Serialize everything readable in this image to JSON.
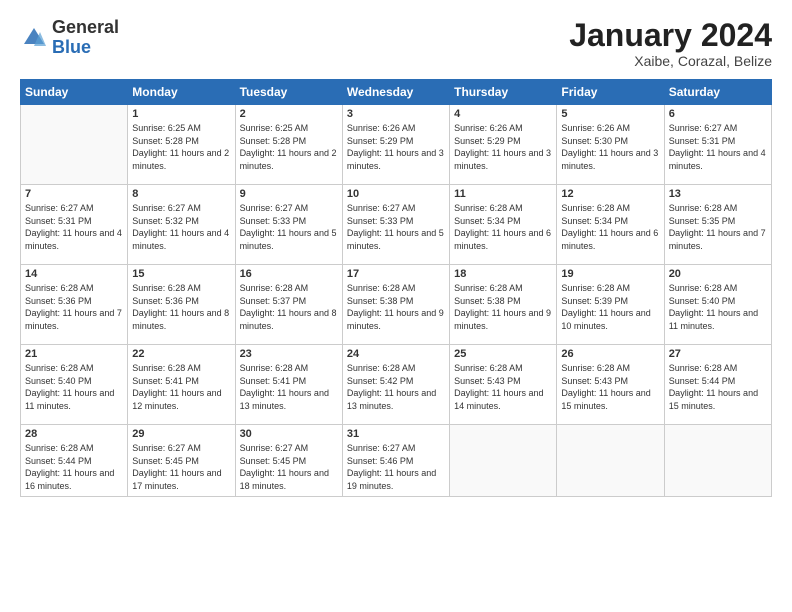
{
  "logo": {
    "general": "General",
    "blue": "Blue"
  },
  "title": "January 2024",
  "location": "Xaibe, Corazal, Belize",
  "weekdays": [
    "Sunday",
    "Monday",
    "Tuesday",
    "Wednesday",
    "Thursday",
    "Friday",
    "Saturday"
  ],
  "weeks": [
    [
      {
        "day": "",
        "sunrise": "",
        "sunset": "",
        "daylight": ""
      },
      {
        "day": "1",
        "sunrise": "Sunrise: 6:25 AM",
        "sunset": "Sunset: 5:28 PM",
        "daylight": "Daylight: 11 hours and 2 minutes."
      },
      {
        "day": "2",
        "sunrise": "Sunrise: 6:25 AM",
        "sunset": "Sunset: 5:28 PM",
        "daylight": "Daylight: 11 hours and 2 minutes."
      },
      {
        "day": "3",
        "sunrise": "Sunrise: 6:26 AM",
        "sunset": "Sunset: 5:29 PM",
        "daylight": "Daylight: 11 hours and 3 minutes."
      },
      {
        "day": "4",
        "sunrise": "Sunrise: 6:26 AM",
        "sunset": "Sunset: 5:29 PM",
        "daylight": "Daylight: 11 hours and 3 minutes."
      },
      {
        "day": "5",
        "sunrise": "Sunrise: 6:26 AM",
        "sunset": "Sunset: 5:30 PM",
        "daylight": "Daylight: 11 hours and 3 minutes."
      },
      {
        "day": "6",
        "sunrise": "Sunrise: 6:27 AM",
        "sunset": "Sunset: 5:31 PM",
        "daylight": "Daylight: 11 hours and 4 minutes."
      }
    ],
    [
      {
        "day": "7",
        "sunrise": "Sunrise: 6:27 AM",
        "sunset": "Sunset: 5:31 PM",
        "daylight": "Daylight: 11 hours and 4 minutes."
      },
      {
        "day": "8",
        "sunrise": "Sunrise: 6:27 AM",
        "sunset": "Sunset: 5:32 PM",
        "daylight": "Daylight: 11 hours and 4 minutes."
      },
      {
        "day": "9",
        "sunrise": "Sunrise: 6:27 AM",
        "sunset": "Sunset: 5:33 PM",
        "daylight": "Daylight: 11 hours and 5 minutes."
      },
      {
        "day": "10",
        "sunrise": "Sunrise: 6:27 AM",
        "sunset": "Sunset: 5:33 PM",
        "daylight": "Daylight: 11 hours and 5 minutes."
      },
      {
        "day": "11",
        "sunrise": "Sunrise: 6:28 AM",
        "sunset": "Sunset: 5:34 PM",
        "daylight": "Daylight: 11 hours and 6 minutes."
      },
      {
        "day": "12",
        "sunrise": "Sunrise: 6:28 AM",
        "sunset": "Sunset: 5:34 PM",
        "daylight": "Daylight: 11 hours and 6 minutes."
      },
      {
        "day": "13",
        "sunrise": "Sunrise: 6:28 AM",
        "sunset": "Sunset: 5:35 PM",
        "daylight": "Daylight: 11 hours and 7 minutes."
      }
    ],
    [
      {
        "day": "14",
        "sunrise": "Sunrise: 6:28 AM",
        "sunset": "Sunset: 5:36 PM",
        "daylight": "Daylight: 11 hours and 7 minutes."
      },
      {
        "day": "15",
        "sunrise": "Sunrise: 6:28 AM",
        "sunset": "Sunset: 5:36 PM",
        "daylight": "Daylight: 11 hours and 8 minutes."
      },
      {
        "day": "16",
        "sunrise": "Sunrise: 6:28 AM",
        "sunset": "Sunset: 5:37 PM",
        "daylight": "Daylight: 11 hours and 8 minutes."
      },
      {
        "day": "17",
        "sunrise": "Sunrise: 6:28 AM",
        "sunset": "Sunset: 5:38 PM",
        "daylight": "Daylight: 11 hours and 9 minutes."
      },
      {
        "day": "18",
        "sunrise": "Sunrise: 6:28 AM",
        "sunset": "Sunset: 5:38 PM",
        "daylight": "Daylight: 11 hours and 9 minutes."
      },
      {
        "day": "19",
        "sunrise": "Sunrise: 6:28 AM",
        "sunset": "Sunset: 5:39 PM",
        "daylight": "Daylight: 11 hours and 10 minutes."
      },
      {
        "day": "20",
        "sunrise": "Sunrise: 6:28 AM",
        "sunset": "Sunset: 5:40 PM",
        "daylight": "Daylight: 11 hours and 11 minutes."
      }
    ],
    [
      {
        "day": "21",
        "sunrise": "Sunrise: 6:28 AM",
        "sunset": "Sunset: 5:40 PM",
        "daylight": "Daylight: 11 hours and 11 minutes."
      },
      {
        "day": "22",
        "sunrise": "Sunrise: 6:28 AM",
        "sunset": "Sunset: 5:41 PM",
        "daylight": "Daylight: 11 hours and 12 minutes."
      },
      {
        "day": "23",
        "sunrise": "Sunrise: 6:28 AM",
        "sunset": "Sunset: 5:41 PM",
        "daylight": "Daylight: 11 hours and 13 minutes."
      },
      {
        "day": "24",
        "sunrise": "Sunrise: 6:28 AM",
        "sunset": "Sunset: 5:42 PM",
        "daylight": "Daylight: 11 hours and 13 minutes."
      },
      {
        "day": "25",
        "sunrise": "Sunrise: 6:28 AM",
        "sunset": "Sunset: 5:43 PM",
        "daylight": "Daylight: 11 hours and 14 minutes."
      },
      {
        "day": "26",
        "sunrise": "Sunrise: 6:28 AM",
        "sunset": "Sunset: 5:43 PM",
        "daylight": "Daylight: 11 hours and 15 minutes."
      },
      {
        "day": "27",
        "sunrise": "Sunrise: 6:28 AM",
        "sunset": "Sunset: 5:44 PM",
        "daylight": "Daylight: 11 hours and 15 minutes."
      }
    ],
    [
      {
        "day": "28",
        "sunrise": "Sunrise: 6:28 AM",
        "sunset": "Sunset: 5:44 PM",
        "daylight": "Daylight: 11 hours and 16 minutes."
      },
      {
        "day": "29",
        "sunrise": "Sunrise: 6:27 AM",
        "sunset": "Sunset: 5:45 PM",
        "daylight": "Daylight: 11 hours and 17 minutes."
      },
      {
        "day": "30",
        "sunrise": "Sunrise: 6:27 AM",
        "sunset": "Sunset: 5:45 PM",
        "daylight": "Daylight: 11 hours and 18 minutes."
      },
      {
        "day": "31",
        "sunrise": "Sunrise: 6:27 AM",
        "sunset": "Sunset: 5:46 PM",
        "daylight": "Daylight: 11 hours and 19 minutes."
      },
      {
        "day": "",
        "sunrise": "",
        "sunset": "",
        "daylight": ""
      },
      {
        "day": "",
        "sunrise": "",
        "sunset": "",
        "daylight": ""
      },
      {
        "day": "",
        "sunrise": "",
        "sunset": "",
        "daylight": ""
      }
    ]
  ]
}
